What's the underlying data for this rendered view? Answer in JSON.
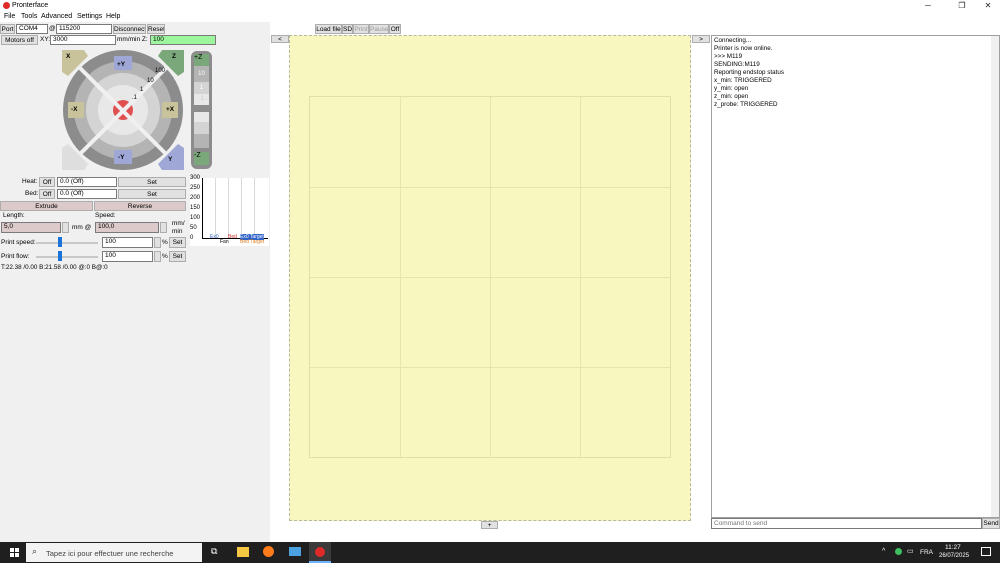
{
  "window": {
    "title": "Pronterface",
    "minimize": "─",
    "maximize": "❐",
    "close": "✕"
  },
  "menu": [
    "File",
    "Tools",
    "Advanced",
    "Settings",
    "Help"
  ],
  "toolbar": {
    "port_label": "Port",
    "port_value": "COM4",
    "at": "@",
    "baud_value": "115200",
    "disconnect": "Disconnect",
    "reset": "Reset",
    "motors_off": "Motors off",
    "xy_label": "XY:",
    "xy_value": "3000",
    "mmmin_z": "mm/min Z:",
    "z_value": "100"
  },
  "center_toolbar": {
    "collapse_left": "<",
    "load_file": "Load file",
    "sd": "SD",
    "print": "Print",
    "pause": "Pause",
    "off": "Off",
    "collapse_right": ">"
  },
  "jog": {
    "home_x": "X",
    "home_y": "Y",
    "home_z": "Z",
    "home_all": "",
    "plus_y": "+Y",
    "minus_y": "-Y",
    "minus_x": "-X",
    "plus_x": "+X",
    "plus_z": "+Z",
    "minus_z": "-Z",
    "step_100": "100",
    "step_10": "10",
    "step_1": "1",
    "step_01": ".1",
    "z_10": "10",
    "z_1": "1",
    "z_01": ".1"
  },
  "temps": {
    "heat_label": "Heat:",
    "heat_off": "Off",
    "heat_value": "0.0 (Off)",
    "heat_set": "Set",
    "bed_label": "Bed:",
    "bed_off": "Off",
    "bed_value": "0.0 (Off)",
    "bed_set": "Set"
  },
  "extrude": {
    "extrude": "Extrude",
    "reverse": "Reverse",
    "length_label": "Length:",
    "speed_label": "Speed:",
    "length_value": "5,0",
    "mm_at": "mm @",
    "speed_value": "100,0",
    "mm_unit": "mm/",
    "min_unit": "min"
  },
  "print_speed": {
    "label": "Print speed:",
    "value": "100",
    "percent": "%",
    "set": "Set",
    "level": 0.38
  },
  "print_flow": {
    "label": "Print flow:",
    "value": "100",
    "percent": "%",
    "set": "Set",
    "level": 0.38
  },
  "status": "T:22.38 /0.00 B:21.58 /0.00 @:0 B@:0",
  "graph": {
    "ticks": [
      "300",
      "250",
      "200",
      "150",
      "100",
      "50",
      "0"
    ],
    "legend": [
      "Ex0",
      "Ex0 Target",
      "Bed",
      "Bed Target",
      "Fan"
    ],
    "legend_colors": [
      "#2f63c9",
      "#2f63c9",
      "#d0302f",
      "#e07a1d",
      "#333333"
    ]
  },
  "log": [
    "Connecting...",
    "Printer is now online.",
    ">>> M119",
    "SENDING:M119",
    "Reporting endstop status",
    "x_min: TRIGGERED",
    "y_min: open",
    "z_min: open",
    "z_probe: TRIGGERED"
  ],
  "command": {
    "placeholder": "Command to send",
    "send": "Send"
  },
  "bottom_toggle": "+",
  "taskbar": {
    "search_placeholder": "Tapez ici pour effectuer une recherche",
    "lang": "FRA",
    "time": "11:27",
    "date": "26/07/2025"
  }
}
